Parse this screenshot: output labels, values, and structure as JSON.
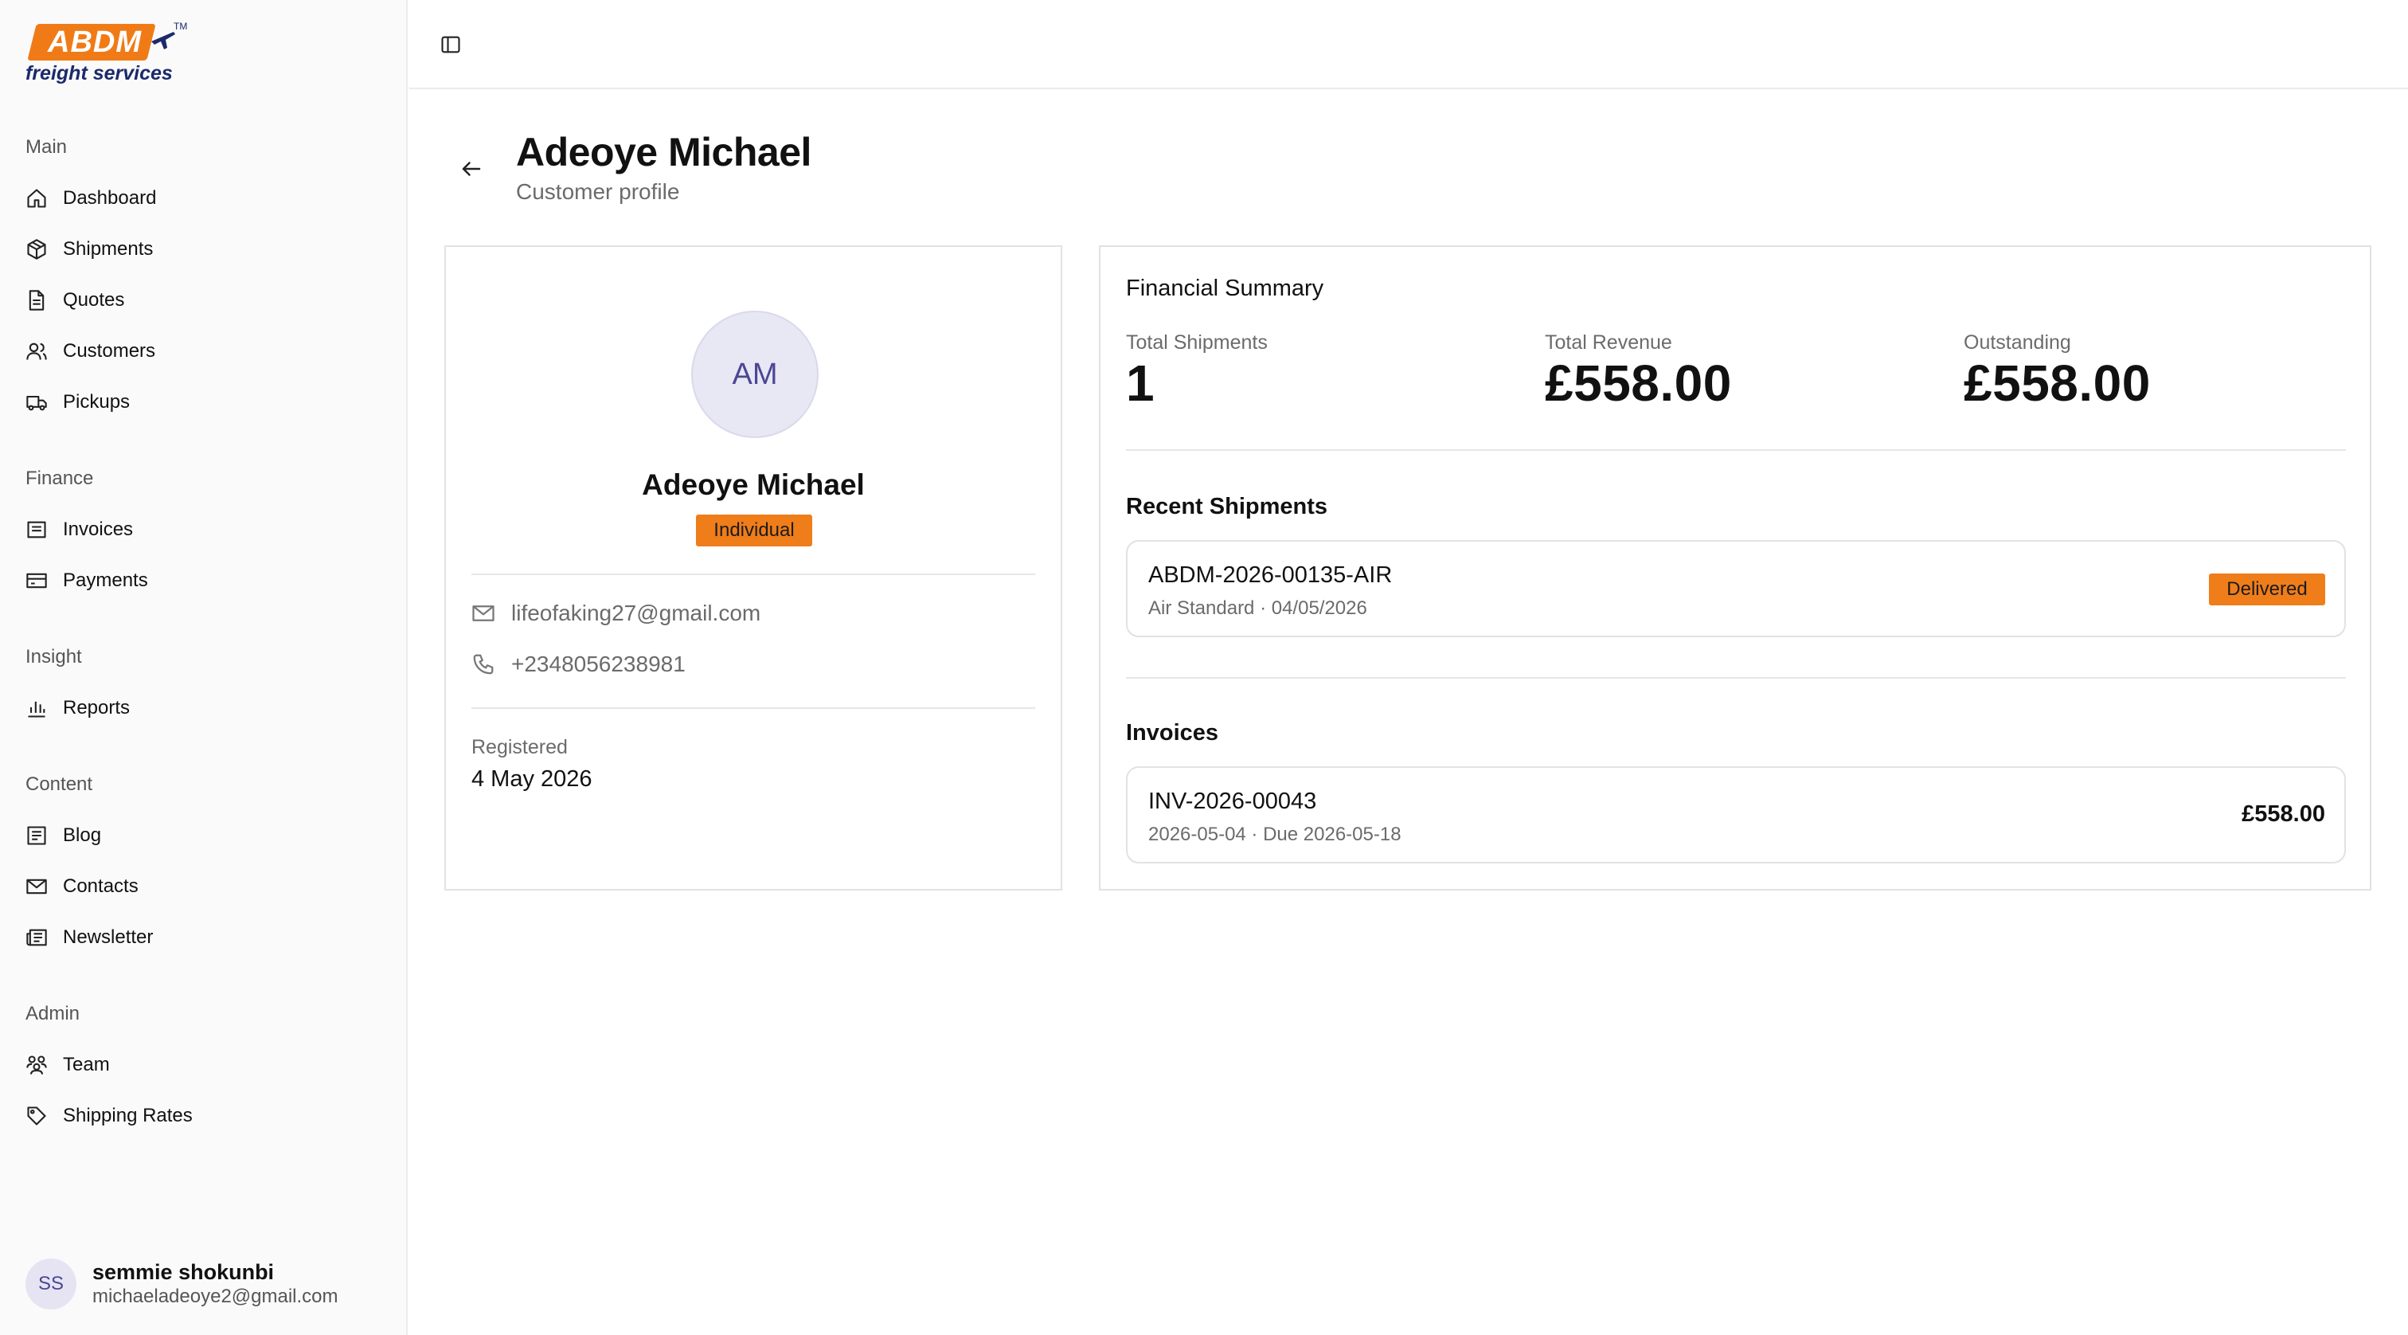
{
  "brand": {
    "logo_text": "ABDM",
    "logo_sub": "freight services",
    "logo_tm": "TM"
  },
  "sidebar": {
    "sections": [
      {
        "label": "Main",
        "items": [
          {
            "label": "Dashboard",
            "icon": "home-icon"
          },
          {
            "label": "Shipments",
            "icon": "package-icon"
          },
          {
            "label": "Quotes",
            "icon": "file-icon"
          },
          {
            "label": "Customers",
            "icon": "users-icon"
          },
          {
            "label": "Pickups",
            "icon": "truck-icon"
          }
        ]
      },
      {
        "label": "Finance",
        "items": [
          {
            "label": "Invoices",
            "icon": "receipt-icon"
          },
          {
            "label": "Payments",
            "icon": "wallet-icon"
          }
        ]
      },
      {
        "label": "Insight",
        "items": [
          {
            "label": "Reports",
            "icon": "bar-chart-icon"
          }
        ]
      },
      {
        "label": "Content",
        "items": [
          {
            "label": "Blog",
            "icon": "newspaper-icon"
          },
          {
            "label": "Contacts",
            "icon": "mail-icon"
          },
          {
            "label": "Newsletter",
            "icon": "newsletter-icon"
          }
        ]
      },
      {
        "label": "Admin",
        "items": [
          {
            "label": "Team",
            "icon": "team-icon"
          },
          {
            "label": "Shipping Rates",
            "icon": "tag-icon"
          }
        ]
      }
    ],
    "user": {
      "initials": "SS",
      "name": "semmie shokunbi",
      "email": "michaeladeoye2@gmail.com"
    }
  },
  "header": {
    "title": "Adeoye Michael",
    "subtitle": "Customer profile"
  },
  "profile": {
    "initials": "AM",
    "name": "Adeoye Michael",
    "type": "Individual",
    "email": "lifeofaking27@gmail.com",
    "phone": "+2348056238981",
    "registered_label": "Registered",
    "registered_value": "4 May 2026"
  },
  "financial": {
    "title": "Financial Summary",
    "stats": [
      {
        "label": "Total Shipments",
        "value": "1"
      },
      {
        "label": "Total Revenue",
        "value": "£558.00"
      },
      {
        "label": "Outstanding",
        "value": "£558.00"
      }
    ],
    "recent_shipments_title": "Recent Shipments",
    "shipments": [
      {
        "id": "ABDM-2026-00135-AIR",
        "meta": "Air Standard · 04/05/2026",
        "status": "Delivered"
      }
    ],
    "invoices_title": "Invoices",
    "invoices": [
      {
        "id": "INV-2026-00043",
        "meta": "2026-05-04 · Due 2026-05-18",
        "amount": "£558.00"
      }
    ]
  },
  "colors": {
    "accent": "#ef7d1a",
    "brand_navy": "#1b2a6b",
    "avatar_bg": "#e8e7f4",
    "avatar_text": "#4a4794"
  }
}
